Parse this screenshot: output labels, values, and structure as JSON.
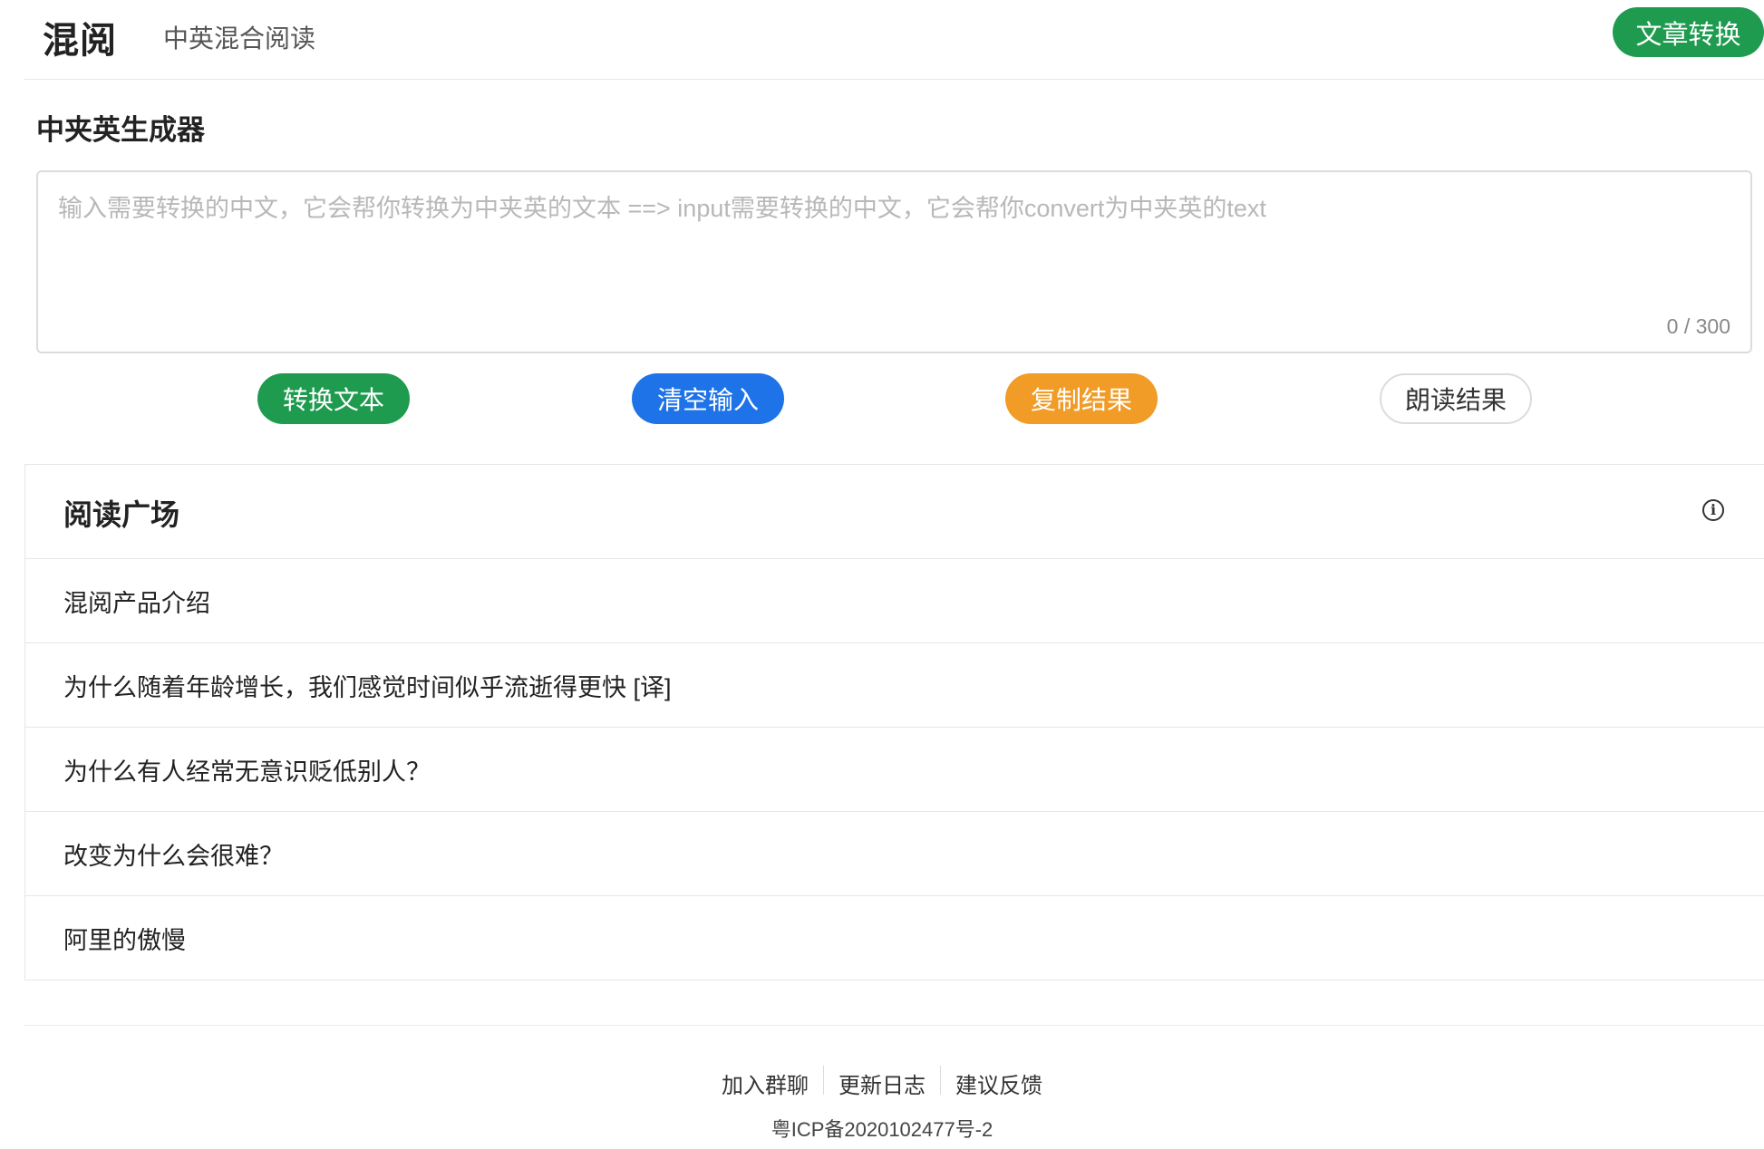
{
  "header": {
    "logo": "混阅",
    "tagline": "中英混合阅读",
    "article_convert_label": "文章转换"
  },
  "generator": {
    "title": "中夹英生成器",
    "input_value": "",
    "placeholder": "输入需要转换的中文，它会帮你转换为中夹英的文本 ==> input需要转换的中文，它会帮你convert为中夹英的text",
    "counter": "0 / 300",
    "buttons": {
      "convert": "转换文本",
      "clear": "清空输入",
      "copy": "复制结果",
      "read": "朗读结果"
    }
  },
  "plaza": {
    "title": "阅读广场",
    "info_icon": "info-circle-icon",
    "items": [
      {
        "label": "混阅产品介绍"
      },
      {
        "label": "为什么随着年龄增长，我们感觉时间似乎流逝得更快 [译]"
      },
      {
        "label": "为什么有人经常无意识贬低别人？"
      },
      {
        "label": "改变为什么会很难？"
      },
      {
        "label": "阿里的傲慢"
      }
    ]
  },
  "footer": {
    "links": [
      "加入群聊",
      "更新日志",
      "建议反馈"
    ],
    "icp": "粤ICP备2020102477号-2"
  },
  "colors": {
    "green": "#1e9b4f",
    "blue": "#1e73e8",
    "orange": "#f09c27",
    "border": "#e6e6e6"
  }
}
